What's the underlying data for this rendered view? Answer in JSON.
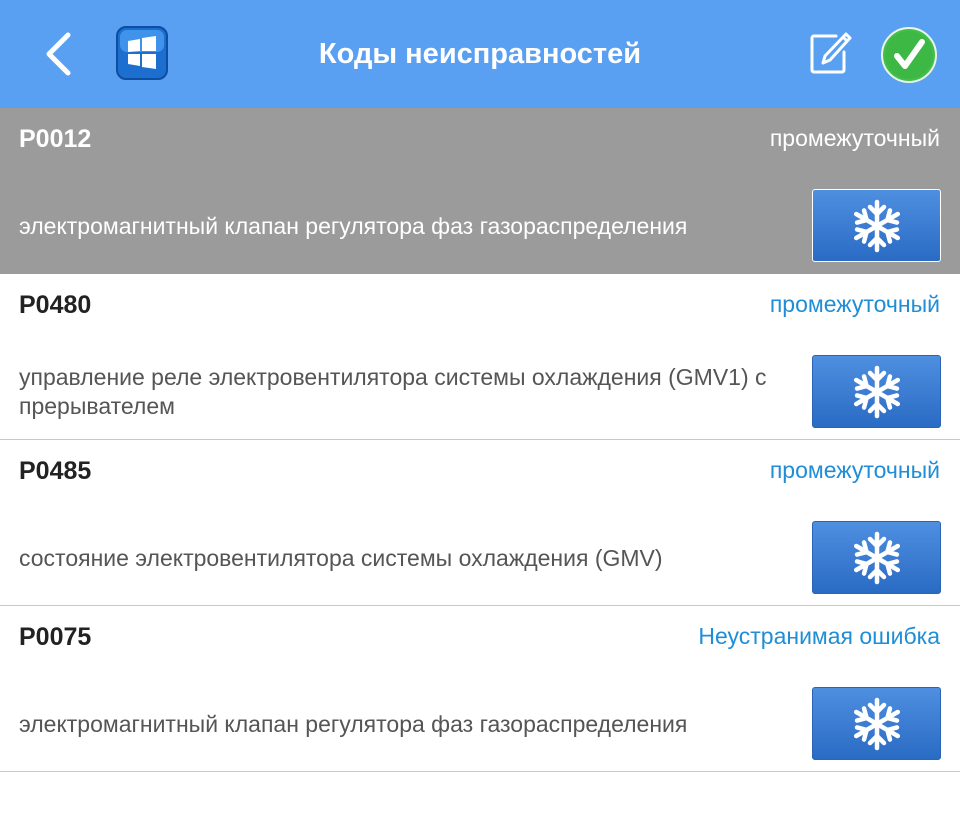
{
  "header": {
    "title": "Коды неисправностей",
    "back_icon": "chevron-left-icon",
    "app_icon": "windows-logo-icon",
    "edit_icon": "edit-icon",
    "ok_icon": "check-icon"
  },
  "colors": {
    "header_bg": "#5aa0f2",
    "selected_row_bg": "#9b9b9b",
    "status_text": "#1f8ed6",
    "freeze_button": "#3a7bd5",
    "ok_green": "#43c04b"
  },
  "faults": [
    {
      "code": "P0012",
      "status": "промежуточный",
      "description": "электромагнитный клапан регулятора фаз газораспределения",
      "selected": true,
      "button_icon": "snowflake-icon"
    },
    {
      "code": "P0480",
      "status": "промежуточный",
      "description": "управление реле электровентилятора системы охлаждения (GMV1) с прерывателем",
      "selected": false,
      "button_icon": "snowflake-icon"
    },
    {
      "code": "P0485",
      "status": "промежуточный",
      "description": "состояние электровентилятора системы охлаждения (GMV)",
      "selected": false,
      "button_icon": "snowflake-icon"
    },
    {
      "code": "P0075",
      "status": "Неустранимая ошибка",
      "description": "электромагнитный клапан регулятора фаз газораспределения",
      "selected": false,
      "button_icon": "snowflake-icon"
    }
  ]
}
